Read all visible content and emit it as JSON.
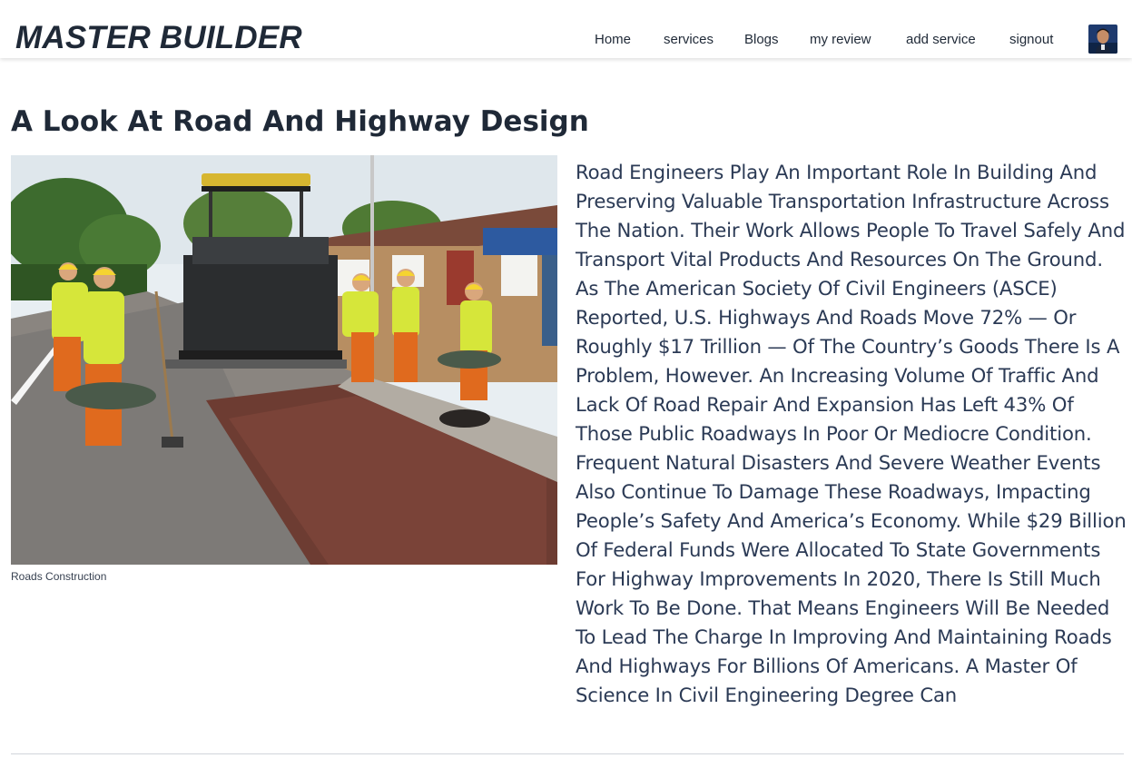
{
  "site": {
    "brand": "MASTER BUILDER"
  },
  "nav": {
    "items": [
      {
        "label": "Home"
      },
      {
        "label": "services"
      },
      {
        "label": "Blogs"
      },
      {
        "label": "my review"
      },
      {
        "label": "add service"
      },
      {
        "label": "signout"
      }
    ],
    "avatar": "user-avatar"
  },
  "blog": {
    "title": "A Look At Road And Highway Design",
    "image_caption": "Roads Construction",
    "body": "Road Engineers Play An Important Role In Building And Preserving Valuable Transportation Infrastructure Across The Nation. Their Work Allows People To Travel Safely And Transport Vital Products And Resources On The Ground. As The American Society Of Civil Engineers (ASCE) Reported, U.S. Highways And Roads Move 72% — Or Roughly $17 Trillion — Of The Country’s Goods There Is A Problem, However. An Increasing Volume Of Traffic And Lack Of Road Repair And Expansion Has Left 43% Of Those Public Roadways In Poor Or Mediocre Condition. Frequent Natural Disasters And Severe Weather Events Also Continue To Damage These Roadways, Impacting People’s Safety And America’s Economy. While $29 Billion Of Federal Funds Were Allocated To State Governments For Highway Improvements In 2020, There Is Still Much Work To Be Done. That Means Engineers Will Be Needed To Lead The Charge In Improving And Maintaining Roads And Highways For Billions Of Americans. A Master Of Science In Civil Engineering Degree Can"
  },
  "colors": {
    "text_dark": "#1f2937",
    "article_text": "#2b3a55",
    "divider": "#d1d5db"
  }
}
